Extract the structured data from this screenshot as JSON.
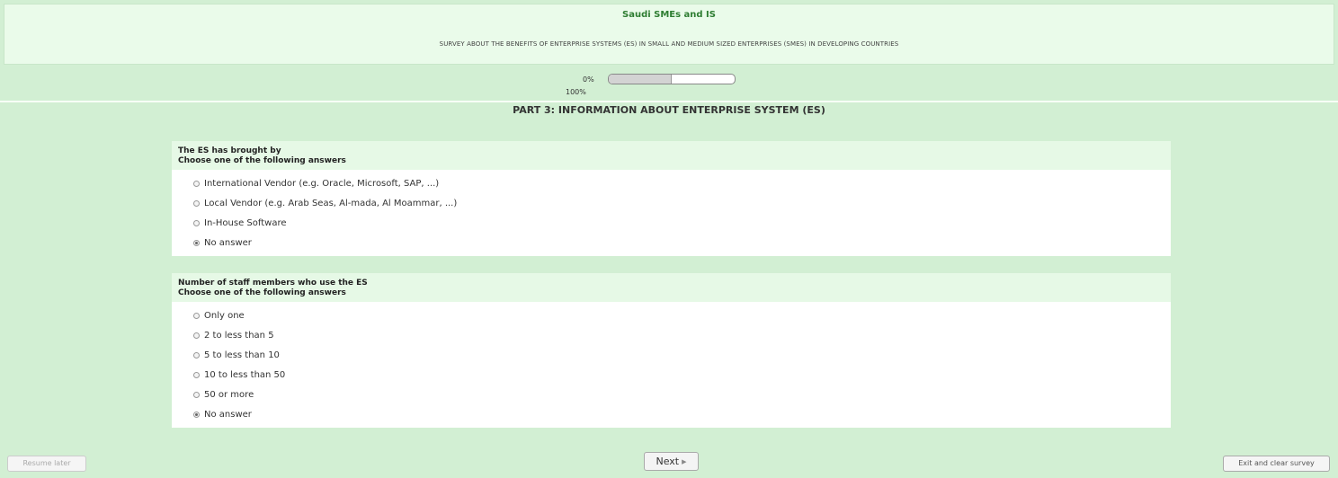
{
  "header": {
    "title": "Saudi SMEs and IS",
    "description": "SURVEY ABOUT THE BENEFITS OF ENTERPRISE SYSTEMS (ES) IN SMALL AND MEDIUM SIZED ENTERPRISES (SMES) IN DEVELOPING COUNTRIES"
  },
  "progress": {
    "left_label": "0%",
    "right_label": "100%",
    "value_fraction": 0.5
  },
  "part_title": "PART 3: INFORMATION ABOUT ENTERPRISE SYSTEM (ES)",
  "questions": [
    {
      "text": "The ES has brought by",
      "help": "Choose one of the following answers",
      "options": [
        "International Vendor (e.g. Oracle, Microsoft, SAP, ...)",
        "Local Vendor (e.g. Arab Seas, Al-mada, Al Moammar, ...)",
        "In-House Software",
        "No answer"
      ],
      "selected": 3
    },
    {
      "text": "Number of staff members who use the ES",
      "help": "Choose one of the following answers",
      "options": [
        "Only one",
        "2 to less than  5",
        "5 to less than  10",
        "10 to less than 50",
        "50 or more",
        "No answer"
      ],
      "selected": 5
    }
  ],
  "buttons": {
    "resume_later": "Resume later",
    "next": "Next",
    "next_icon": "chevron-right-icon",
    "exit": "Exit and clear survey"
  },
  "colors": {
    "page_bg": "#d2efd3",
    "header_bg": "#eafbea",
    "title_green": "#2e7d32"
  }
}
